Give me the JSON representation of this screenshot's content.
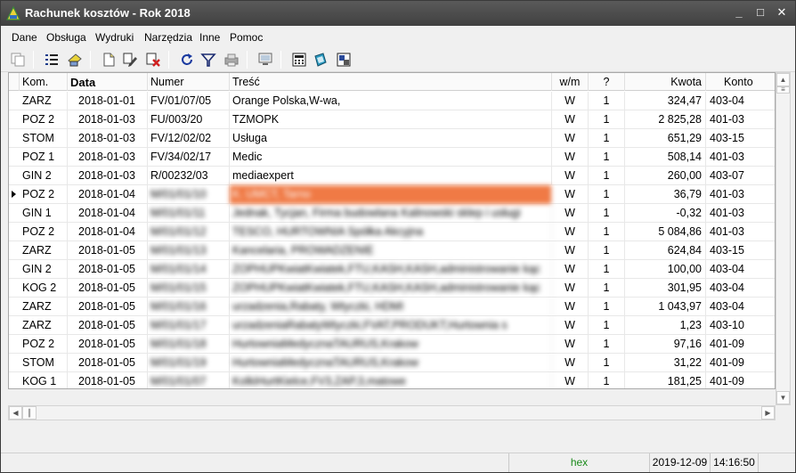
{
  "window": {
    "title": "Rachunek kosztów - Rok 2018",
    "minimize": "_",
    "maximize": "□",
    "close": "✕"
  },
  "menu": [
    "Dane",
    "Obsługa",
    "Wydruki",
    "Narzędzia",
    "Inne",
    "Pomoc"
  ],
  "toolbar_icons": [
    "copy-icon",
    "list-icon",
    "paint-icon",
    "new-document-icon",
    "edit-icon",
    "delete-icon",
    "refresh-icon",
    "filter-icon",
    "print-icon",
    "monitor-icon",
    "calculator-icon",
    "book-icon",
    "zoom-icon"
  ],
  "columns": [
    "Kom.",
    "Data",
    "Numer",
    "Treść",
    "w/m",
    "?",
    "Kwota",
    "Konto"
  ],
  "rows": [
    {
      "kom": "ZARZ",
      "data": "2018-01-01",
      "numer": "FV/01/07/05",
      "tresc": "Orange Polska,W-wa,",
      "wm": "W",
      "q": "1",
      "kwota": "324,47",
      "konto": "403-04"
    },
    {
      "kom": "POZ 2",
      "data": "2018-01-03",
      "numer": "FU/003/20",
      "tresc": "TZMOPK",
      "wm": "W",
      "q": "1",
      "kwota": "2 825,28",
      "konto": "401-03"
    },
    {
      "kom": "STOM",
      "data": "2018-01-03",
      "numer": "FV/12/02/02",
      "tresc": "Usługa",
      "wm": "W",
      "q": "1",
      "kwota": "651,29",
      "konto": "403-15"
    },
    {
      "kom": "POZ 1",
      "data": "2018-01-03",
      "numer": "FV/34/02/17",
      "tresc": "Medic",
      "wm": "W",
      "q": "1",
      "kwota": "508,14",
      "konto": "401-03"
    },
    {
      "kom": "GIN 2",
      "data": "2018-01-03",
      "numer": "R/00232/03",
      "tresc": "mediaexpert",
      "wm": "W",
      "q": "1",
      "kwota": "260,00",
      "konto": "403-07"
    },
    {
      "kom": "POZ 2",
      "data": "2018-01-04",
      "numer": "M/01/01/10",
      "tresc": "K. UMCT, Tarno",
      "wm": "W",
      "q": "1",
      "kwota": "36,79",
      "konto": "401-03",
      "selected": true
    },
    {
      "kom": "GIN 1",
      "data": "2018-01-04",
      "numer": "M/01/01/11",
      "tresc": "Jednak, Tycjan, Firma budowlana Kalinowski sklep i usługi",
      "wm": "W",
      "q": "1",
      "kwota": "-0,32",
      "konto": "401-03"
    },
    {
      "kom": "POZ 2",
      "data": "2018-01-04",
      "numer": "M/01/01/12",
      "tresc": "TESCO, HURTOWNIA Spółka Akcyjna",
      "wm": "W",
      "q": "1",
      "kwota": "5 084,86",
      "konto": "401-03"
    },
    {
      "kom": "ZARZ",
      "data": "2018-01-05",
      "numer": "M/01/01/13",
      "tresc": "Kancelaria, PROWADZENIE",
      "wm": "W",
      "q": "1",
      "kwota": "624,84",
      "konto": "403-15"
    },
    {
      "kom": "GIN 2",
      "data": "2018-01-05",
      "numer": "M/01/01/14",
      "tresc": "ZOPHUPKwiatKwiatek,FTU,KASH,KASH,administrowanie kąc",
      "wm": "W",
      "q": "1",
      "kwota": "100,00",
      "konto": "403-04"
    },
    {
      "kom": "KOG 2",
      "data": "2018-01-05",
      "numer": "M/01/01/15",
      "tresc": "ZOPHUPKwiatKwiatek,FTU,KASH,KASH,administrowanie kąc",
      "wm": "W",
      "q": "1",
      "kwota": "301,95",
      "konto": "403-04"
    },
    {
      "kom": "ZARZ",
      "data": "2018-01-05",
      "numer": "M/01/01/16",
      "tresc": "urzadzenia,Rabaty, Wtyczki, HDMI",
      "wm": "W",
      "q": "1",
      "kwota": "1 043,97",
      "konto": "403-04"
    },
    {
      "kom": "ZARZ",
      "data": "2018-01-05",
      "numer": "M/01/01/17",
      "tresc": "urzadzeniaRabatyWtyczki,FVAT,PRODUKT,Hurtownia s",
      "wm": "W",
      "q": "1",
      "kwota": "1,23",
      "konto": "403-10"
    },
    {
      "kom": "POZ 2",
      "data": "2018-01-05",
      "numer": "M/01/01/18",
      "tresc": "HurtowniaMedycznaTAURUS,Krakow",
      "wm": "W",
      "q": "1",
      "kwota": "97,16",
      "konto": "401-09"
    },
    {
      "kom": "STOM",
      "data": "2018-01-05",
      "numer": "M/01/01/19",
      "tresc": "HurtowniaMedycznaTAURUS,Krakow",
      "wm": "W",
      "q": "1",
      "kwota": "31,22",
      "konto": "401-09"
    },
    {
      "kom": "KOG 1",
      "data": "2018-01-05",
      "numer": "M/01/01/07",
      "tresc": "KolkiHurtKielce,FV3,ZAP,3,matowe",
      "wm": "W",
      "q": "1",
      "kwota": "181,25",
      "konto": "401-09"
    }
  ],
  "status": {
    "mode": "hex",
    "date": "2019-12-09",
    "time": "14:16:50"
  }
}
